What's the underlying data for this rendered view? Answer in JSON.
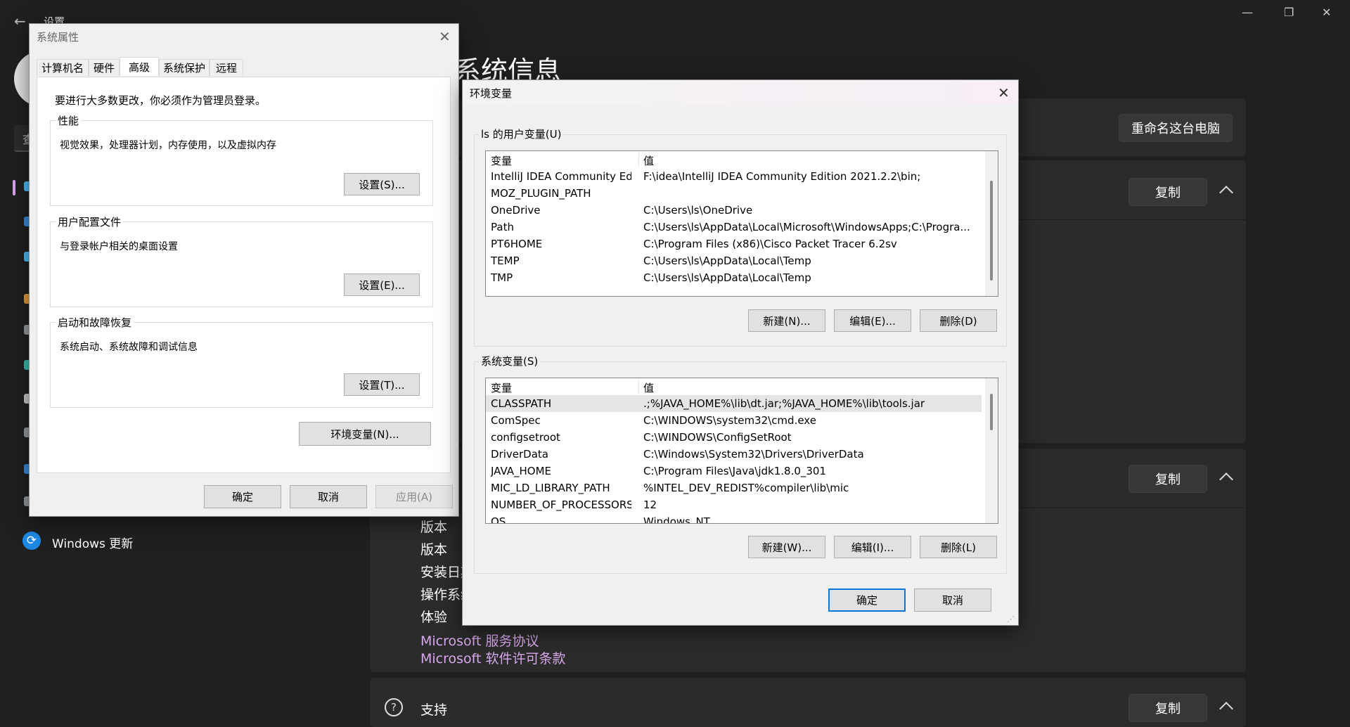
{
  "settings": {
    "app_title": "设置",
    "page_title": "系统信息",
    "search_placeholder": "查",
    "rename_button": "重命名这台电脑",
    "copy_button": "复制",
    "windows_spec_items": [
      "版本",
      "版本",
      "安装日期",
      "操作系统",
      "体验"
    ],
    "links": [
      "Microsoft 服务协议",
      "Microsoft 软件许可条款"
    ],
    "support_label": "支持",
    "nav_windows_update": "Windows 更新",
    "window_controls": {
      "minimize": "—",
      "restore": "❐",
      "close": "✕"
    },
    "accent_color": "#0078d4",
    "link_color": "#d7a8ec"
  },
  "sysprops": {
    "title": "系统属性",
    "tabs": [
      "计算机名",
      "硬件",
      "高级",
      "系统保护",
      "远程"
    ],
    "active_tab": "高级",
    "admin_note": "要进行大多数更改，你必须作为管理员登录。",
    "performance": {
      "label": "性能",
      "desc": "视觉效果，处理器计划，内存使用，以及虚拟内存",
      "button": "设置(S)..."
    },
    "profiles": {
      "label": "用户配置文件",
      "desc": "与登录帐户相关的桌面设置",
      "button": "设置(E)..."
    },
    "startup": {
      "label": "启动和故障恢复",
      "desc": "系统启动、系统故障和调试信息",
      "button": "设置(T)..."
    },
    "env_button": "环境变量(N)...",
    "ok": "确定",
    "cancel": "取消",
    "apply": "应用(A)"
  },
  "envvars": {
    "title": "环境变量",
    "user_group_label": "ls 的用户变量(U)",
    "system_group_label": "系统变量(S)",
    "col_var": "变量",
    "col_val": "值",
    "user_vars": [
      {
        "name": "IntelliJ IDEA Community Ed...",
        "value": "F:\\idea\\IntelliJ IDEA Community Edition 2021.2.2\\bin;"
      },
      {
        "name": "MOZ_PLUGIN_PATH",
        "value": ""
      },
      {
        "name": "OneDrive",
        "value": "C:\\Users\\ls\\OneDrive"
      },
      {
        "name": "Path",
        "value": "C:\\Users\\ls\\AppData\\Local\\Microsoft\\WindowsApps;C:\\Progra..."
      },
      {
        "name": "PT6HOME",
        "value": "C:\\Program Files (x86)\\Cisco Packet Tracer 6.2sv"
      },
      {
        "name": "TEMP",
        "value": "C:\\Users\\ls\\AppData\\Local\\Temp"
      },
      {
        "name": "TMP",
        "value": "C:\\Users\\ls\\AppData\\Local\\Temp"
      }
    ],
    "system_vars": [
      {
        "name": "CLASSPATH",
        "value": ".;%JAVA_HOME%\\lib\\dt.jar;%JAVA_HOME%\\lib\\tools.jar"
      },
      {
        "name": "ComSpec",
        "value": "C:\\WINDOWS\\system32\\cmd.exe"
      },
      {
        "name": "configsetroot",
        "value": "C:\\WINDOWS\\ConfigSetRoot"
      },
      {
        "name": "DriverData",
        "value": "C:\\Windows\\System32\\Drivers\\DriverData"
      },
      {
        "name": "JAVA_HOME",
        "value": "C:\\Program Files\\Java\\jdk1.8.0_301"
      },
      {
        "name": "MIC_LD_LIBRARY_PATH",
        "value": "%INTEL_DEV_REDIST%compiler\\lib\\mic"
      },
      {
        "name": "NUMBER_OF_PROCESSORS",
        "value": "12"
      },
      {
        "name": "OS",
        "value": "Windows_NT"
      }
    ],
    "user_buttons": {
      "new": "新建(N)...",
      "edit": "编辑(E)...",
      "delete": "删除(D)"
    },
    "system_buttons": {
      "new": "新建(W)...",
      "edit": "编辑(I)...",
      "delete": "删除(L)"
    },
    "ok": "确定",
    "cancel": "取消"
  }
}
